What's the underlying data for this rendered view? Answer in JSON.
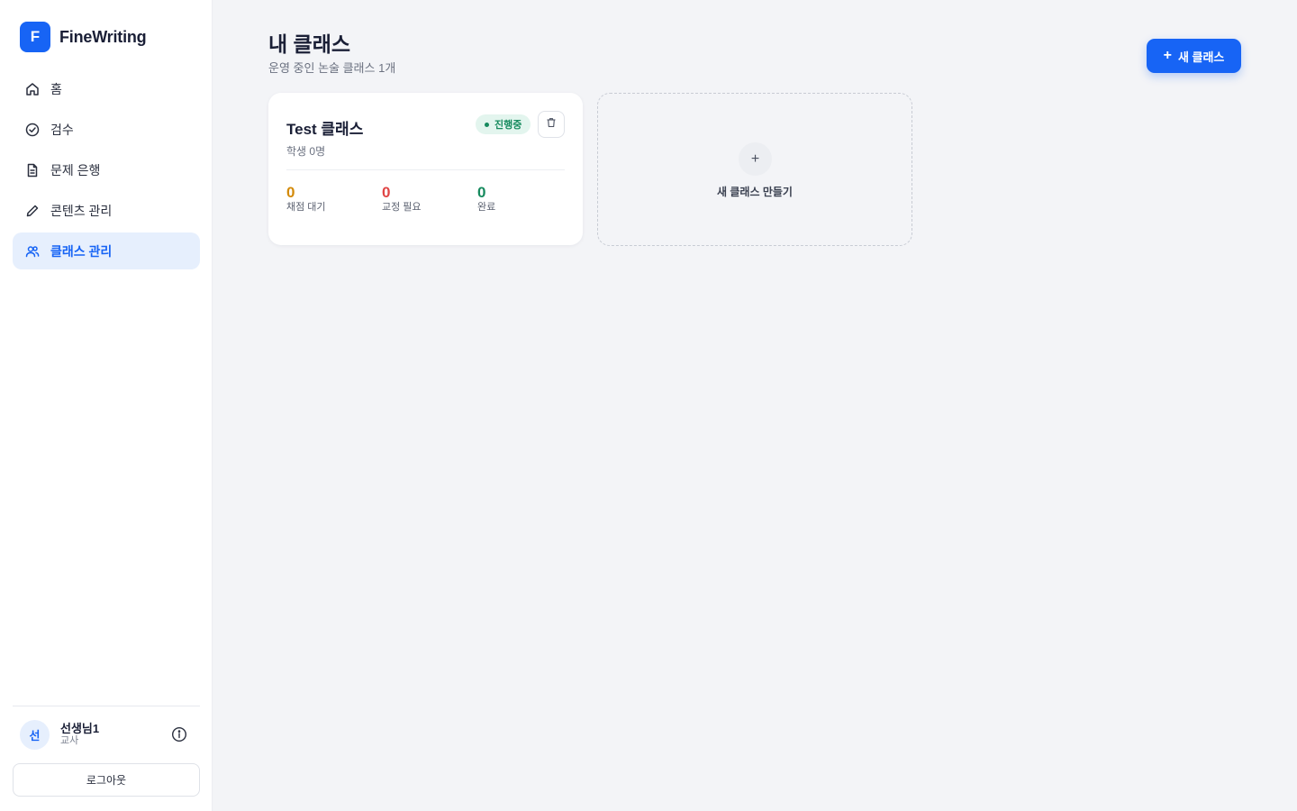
{
  "brand": {
    "logo_letter": "F",
    "name": "FineWriting"
  },
  "nav": {
    "items": [
      {
        "label": "홈",
        "icon": "home-icon"
      },
      {
        "label": "검수",
        "icon": "check-circle-icon"
      },
      {
        "label": "문제 은행",
        "icon": "document-icon"
      },
      {
        "label": "콘텐츠 관리",
        "icon": "pencil-icon"
      },
      {
        "label": "클래스 관리",
        "icon": "users-icon",
        "active": true
      }
    ]
  },
  "user": {
    "avatar_initial": "선",
    "name": "선생님1",
    "role": "교사",
    "logout_label": "로그아웃"
  },
  "header": {
    "title": "내 클래스",
    "subtitle": "운영 중인 논술 클래스 1개",
    "new_button_label": "새 클래스",
    "new_button_icon": "+"
  },
  "classes": [
    {
      "title": "Test 클래스",
      "status": "진행중",
      "meta": "학생 0명",
      "stats": [
        {
          "value": "0",
          "label": "채점 대기",
          "color": "#d38a0a"
        },
        {
          "value": "0",
          "label": "교정 필요",
          "color": "#e04545"
        },
        {
          "value": "0",
          "label": "완료",
          "color": "#168a5e"
        }
      ]
    }
  ],
  "create_card": {
    "icon": "+",
    "label": "새 클래스 만들기"
  },
  "colors": {
    "accent": "#1764f5",
    "status_green": "#168a5e",
    "background": "#f3f4f7"
  }
}
